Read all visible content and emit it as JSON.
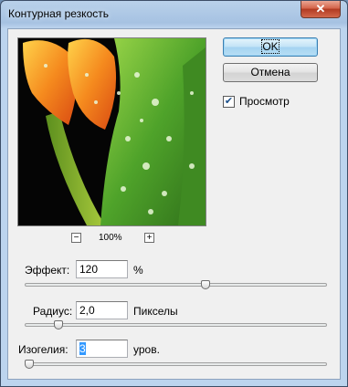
{
  "window": {
    "title": "Контурная резкость",
    "close_glyph": "✕"
  },
  "preview": {
    "zoom_out_glyph": "−",
    "zoom_in_glyph": "+",
    "zoom_level": "100%"
  },
  "buttons": {
    "ok": "OK",
    "cancel": "Отмена"
  },
  "preview_toggle": {
    "label": "Просмотр",
    "checked": true,
    "check_glyph": "✔"
  },
  "amount": {
    "label": "Эффект:",
    "value": "120",
    "unit": "%",
    "slider_fraction": 0.6
  },
  "radius": {
    "label": "Радиус:",
    "value": "2,0",
    "unit": "Пикселы",
    "slider_fraction": 0.1
  },
  "threshold": {
    "label": "Изогелия:",
    "value": "3",
    "unit": "уров.",
    "slider_fraction": 0.0
  },
  "colors": {
    "title_bar": "#a9c6e6",
    "ok_border": "#3c7fb1",
    "close_red": "#c8503a",
    "selection": "#3399ff"
  }
}
